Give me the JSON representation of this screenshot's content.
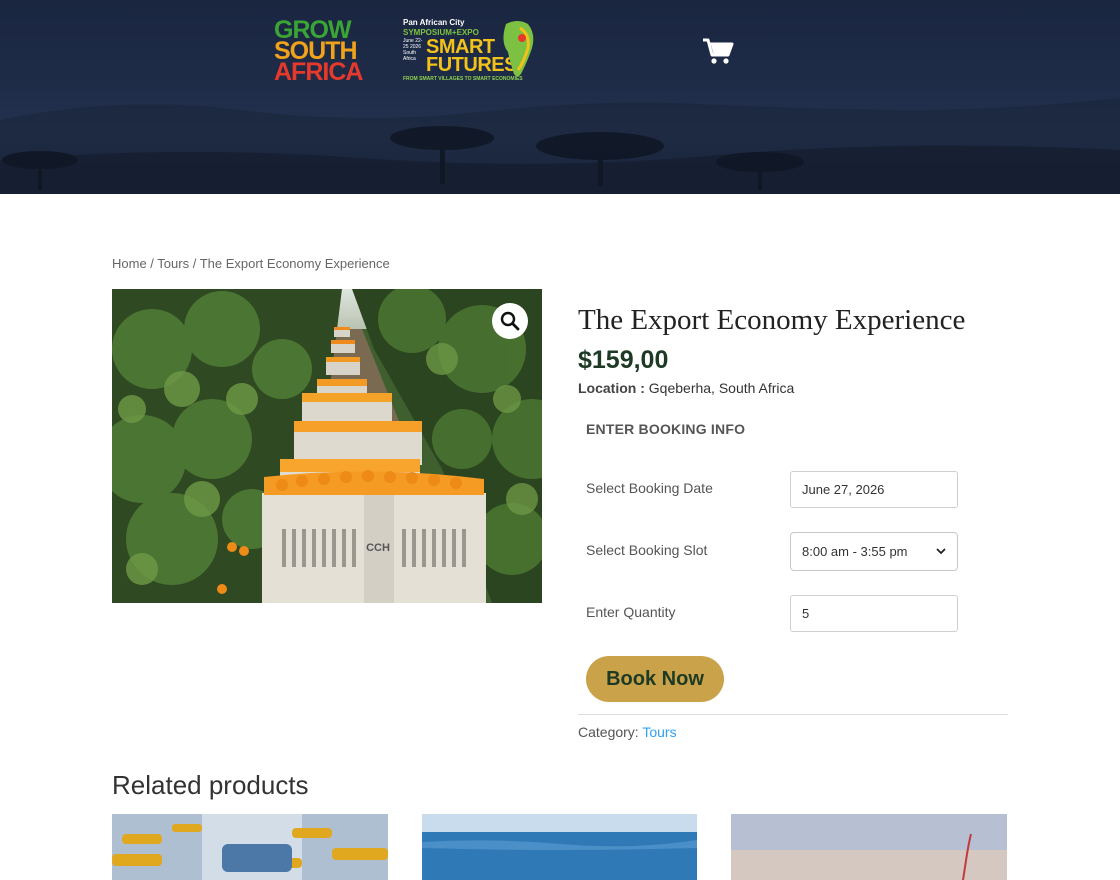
{
  "colors": {
    "header_bg": "#1f2c48",
    "price": "#1e3a24",
    "book_button_bg": "#c9a24a",
    "book_button_text": "#1e3a24",
    "link": "#2ea3f2"
  },
  "header": {
    "logo_grow": {
      "line1": "GROW",
      "line2": "SOUTH",
      "line3": "AFRICA"
    },
    "logo_expo": {
      "line1": "Pan African City",
      "line2": "SYMPOSIUM+EXPO",
      "title": "SMART FUTURES",
      "dates": "June 22-25 2026 South Africa",
      "tagline": "FROM SMART VILLAGES TO SMART ECONOMIES"
    },
    "cart_icon": "shopping-cart-icon"
  },
  "breadcrumb": {
    "items": [
      "Home",
      "Tours",
      "The Export Economy Experience"
    ],
    "separator": " / "
  },
  "product": {
    "title": "The Export Economy Experience",
    "price": "$159,00",
    "location_label": "Location :",
    "location_value": "Gqeberha, South Africa",
    "image_alt": "Orange crates in citrus orchard",
    "zoom_icon": "magnifier-icon",
    "crate_text": "CCH"
  },
  "booking": {
    "heading": "ENTER BOOKING INFO",
    "date_label": "Select Booking Date",
    "date_value": "June 27, 2026",
    "slot_label": "Select Booking Slot",
    "slot_value": "8:00 am - 3:55 pm",
    "quantity_label": "Enter Quantity",
    "quantity_value": "5",
    "book_button": "Book Now"
  },
  "meta": {
    "category_label": "Category:",
    "category_value": "Tours"
  },
  "related": {
    "heading": "Related products"
  }
}
